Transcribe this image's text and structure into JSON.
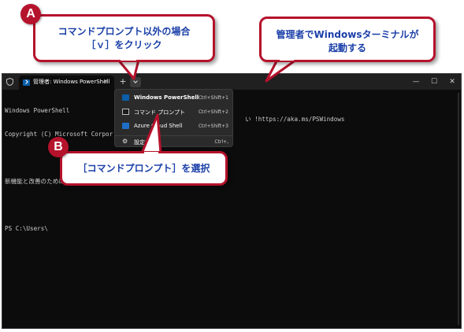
{
  "window": {
    "tab_title": "管理者: Windows PowerShell",
    "tab_close": "✕",
    "new_tab": "+",
    "minimize": "—",
    "maximize": "☐",
    "close": "✕"
  },
  "console": {
    "lines": [
      "Windows PowerShell",
      "Copyright (C) Microsoft Corpor",
      "",
      "新機能と改善のために最新の  Pow",
      "",
      "PS C:\\Users\\"
    ],
    "right_fragment": "い !https://aka.ms/PSWindows"
  },
  "menu": {
    "items": [
      {
        "label": "Windows PowerShell",
        "shortcut": "Ctrl+Shift+1",
        "icon": "powershell-icon"
      },
      {
        "label": "コマンド プロンプト",
        "shortcut": "Ctrl+Shift+2",
        "icon": "command-prompt-icon"
      },
      {
        "label": "Azure Cloud Shell",
        "shortcut": "Ctrl+Shift+3",
        "icon": "azure-icon"
      },
      {
        "label": "設定",
        "shortcut": "Ctrl+,",
        "icon": "gear-icon"
      }
    ]
  },
  "callouts": {
    "a_badge": "A",
    "a_line1": "コマンドプロンプト以外の場合",
    "a_line2": "［ｖ］をクリック",
    "win_line1": "管理者でWindowsターミナルが",
    "win_line2": "起動する",
    "b_badge": "B",
    "b_text": "［コマンドプロンプト］を選択"
  },
  "colors": {
    "accent_red": "#b5122c",
    "callout_text_blue": "#1a3fa8",
    "terminal_bg": "#0c0c0c",
    "titlebar_bg": "#202020"
  }
}
